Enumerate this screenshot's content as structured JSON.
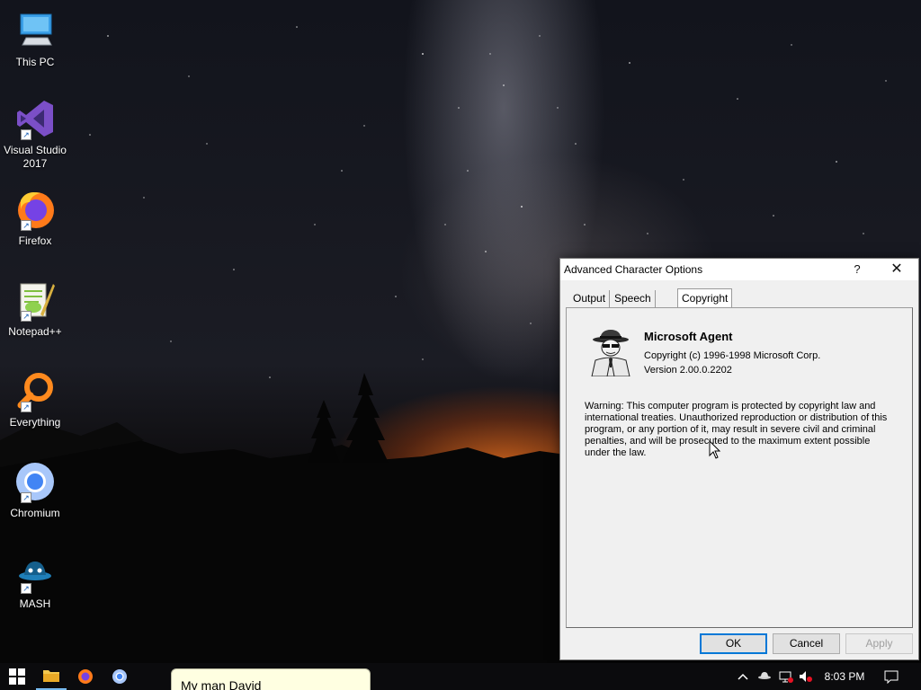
{
  "desktop": {
    "icons": [
      {
        "label": "This PC",
        "icon": "computer-icon"
      },
      {
        "label": "Visual Studio 2017",
        "icon": "visual-studio-icon"
      },
      {
        "label": "Firefox",
        "icon": "firefox-icon"
      },
      {
        "label": "Notepad++",
        "icon": "notepadpp-icon"
      },
      {
        "label": "Everything",
        "icon": "everything-search-icon"
      },
      {
        "label": "Chromium",
        "icon": "chromium-icon"
      },
      {
        "label": "MASH",
        "icon": "mash-icon"
      }
    ]
  },
  "dialog": {
    "title": "Advanced Character Options",
    "help_label": "?",
    "close_label": "✕",
    "tabs": [
      {
        "label": "Output",
        "active": false
      },
      {
        "label": "Speech Input",
        "active": false
      },
      {
        "label": "Copyright",
        "active": true
      }
    ],
    "product_name": "Microsoft Agent",
    "copyright": "Copyright (c) 1996-1998 Microsoft Corp.",
    "version": "Version 2.00.0.2202",
    "warning": "Warning: This computer program is protected by copyright law and international treaties.  Unauthorized reproduction or distribution of this program, or any portion of it, may result in severe civil and criminal penalties, and will be prosecuted to the maximum extent possible under the law.",
    "buttons": {
      "ok": "OK",
      "cancel": "Cancel",
      "apply": "Apply"
    }
  },
  "taskbar": {
    "pinned": [
      "windows-start-icon",
      "file-explorer-icon",
      "firefox-icon",
      "chromium-icon"
    ],
    "tray_icons": [
      "chevron-up-icon",
      "agent-tray-icon",
      "network-icon",
      "volume-muted-icon"
    ],
    "time": "8:03 PM",
    "notification_icon": "action-center-icon"
  },
  "balloon": {
    "text": "My man David"
  },
  "colors": {
    "accent": "#0078d7",
    "taskbar": "#0b0b0d",
    "balloon": "#ffffe1"
  }
}
